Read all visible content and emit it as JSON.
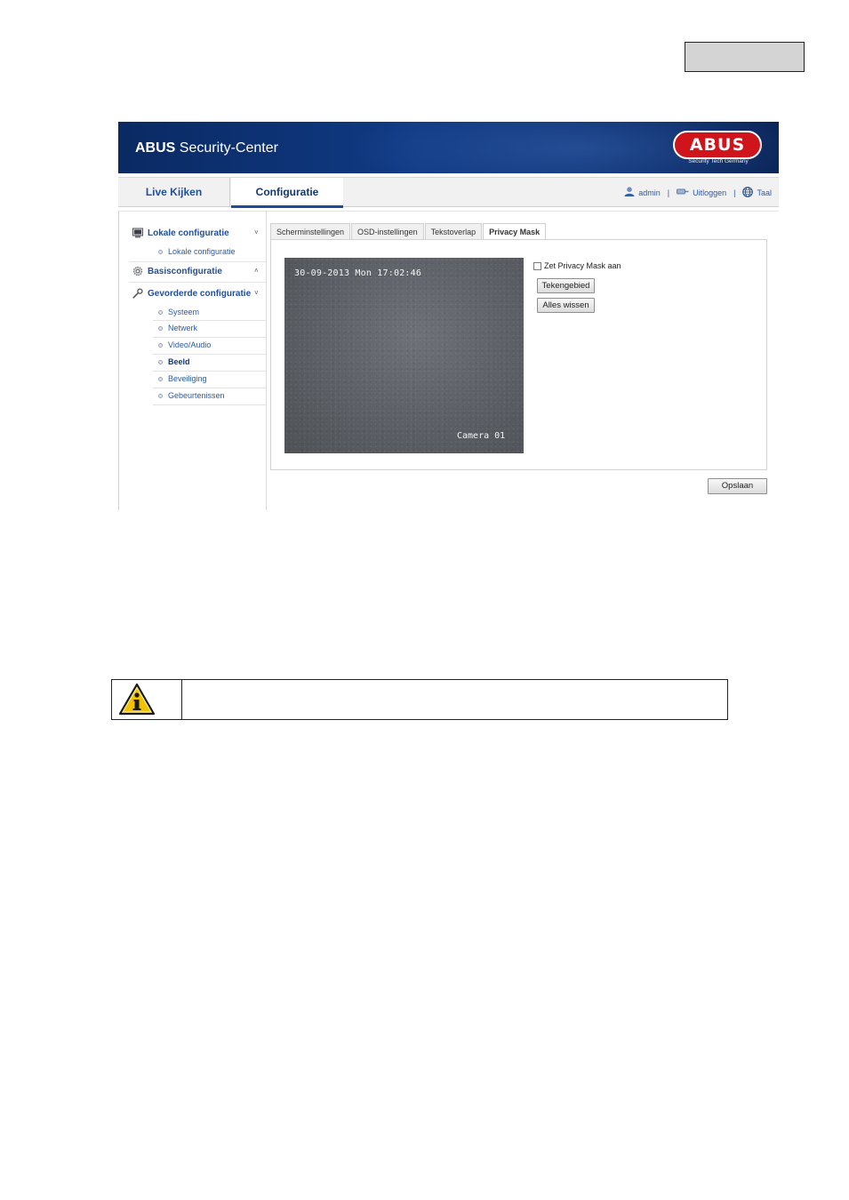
{
  "header": {
    "brand_bold": "ABUS",
    "brand_rest": " Security-Center",
    "logo_text": "ABUS",
    "logo_subtitle": "Security Tech Germany"
  },
  "nav": {
    "tabs": [
      {
        "label": "Live Kijken"
      },
      {
        "label": "Configuratie"
      }
    ],
    "user": "admin",
    "separator": "|",
    "logout": "Uitloggen",
    "language": "Taal"
  },
  "sidebar": {
    "local": {
      "label": "Lokale configuratie",
      "items": [
        "Lokale configuratie"
      ]
    },
    "basic": {
      "label": "Basisconfiguratie"
    },
    "advanced": {
      "label": "Gevorderde configuratie",
      "items": [
        "Systeem",
        "Netwerk",
        "Video/Audio",
        "Beeld",
        "Beveiliging",
        "Gebeurtenissen"
      ],
      "active": "Beeld"
    },
    "chevron_down": "˅",
    "chevron_up": "˄"
  },
  "subtabs": [
    "Scherminstellingen",
    "OSD-instellingen",
    "Tekstoverlap",
    "Privacy Mask"
  ],
  "active_subtab": "Privacy Mask",
  "camera": {
    "timestamp": "30-09-2013 Mon 17:02:46",
    "name": "Camera 01"
  },
  "controls": {
    "enable_mask_label": "Zet Privacy Mask aan",
    "enable_mask_checked": false,
    "draw_area_label": "Tekengebied",
    "clear_all_label": "Alles wissen",
    "save_label": "Opslaan"
  },
  "colors": {
    "header_bg": "#103a84",
    "link_blue": "#1f4e9c",
    "logo_red": "#d0141b",
    "notice_icon_yellow": "#f2c200"
  }
}
